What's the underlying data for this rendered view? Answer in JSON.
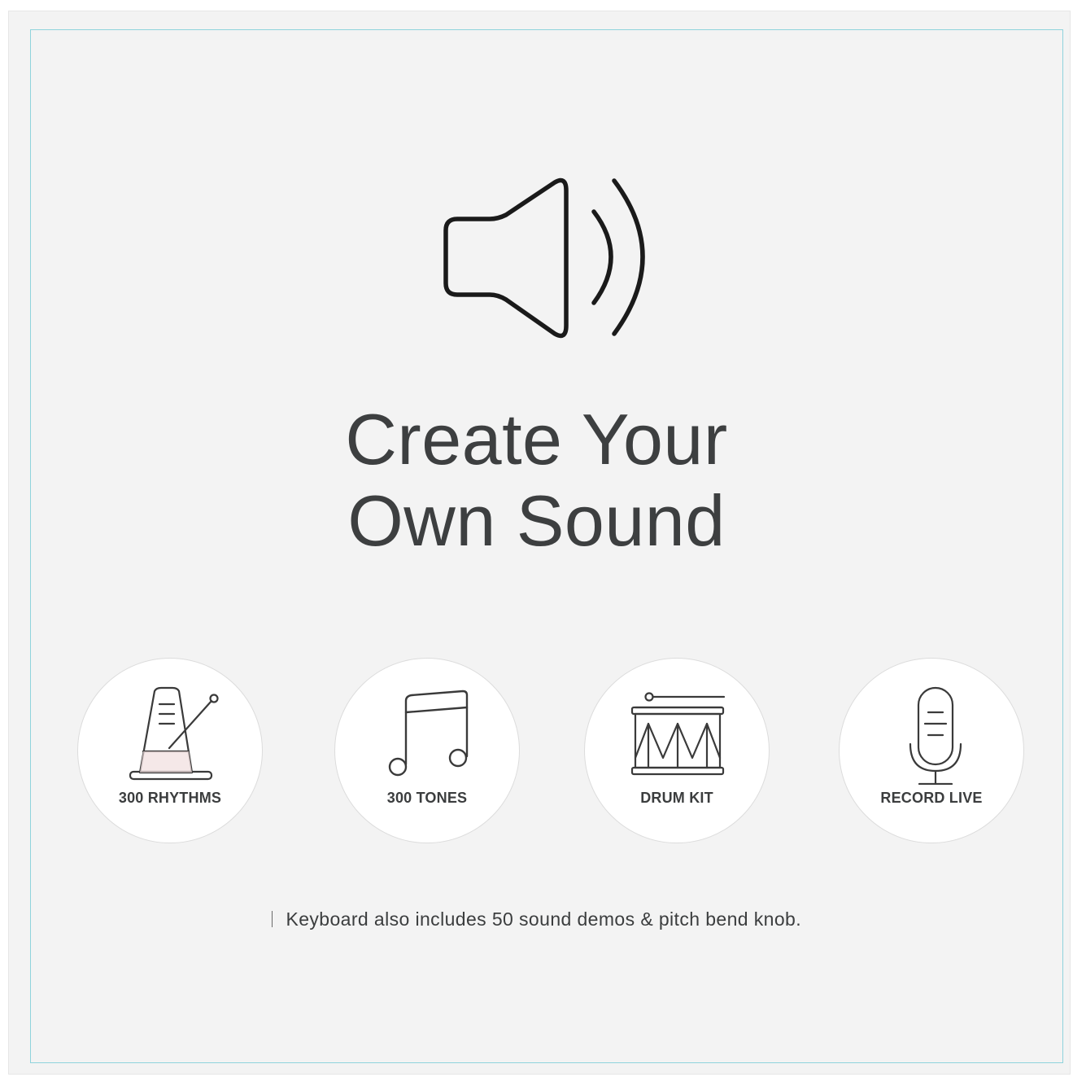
{
  "hero": {
    "icon": "speaker-volume-icon",
    "title_line1": "Create Your",
    "title_line2": "Own Sound"
  },
  "features": [
    {
      "icon": "metronome-icon",
      "label": "300 RHYTHMS"
    },
    {
      "icon": "music-note-icon",
      "label": "300 TONES"
    },
    {
      "icon": "drum-icon",
      "label": "DRUM KIT"
    },
    {
      "icon": "microphone-icon",
      "label": "RECORD LIVE"
    }
  ],
  "footnote": {
    "text": "Keyboard also includes 50 sound demos & pitch bend knob."
  },
  "colors": {
    "background": "#f3f3f3",
    "frame_border": "#8fd3dc",
    "text": "#3d3f40",
    "circle": "#ffffff"
  }
}
